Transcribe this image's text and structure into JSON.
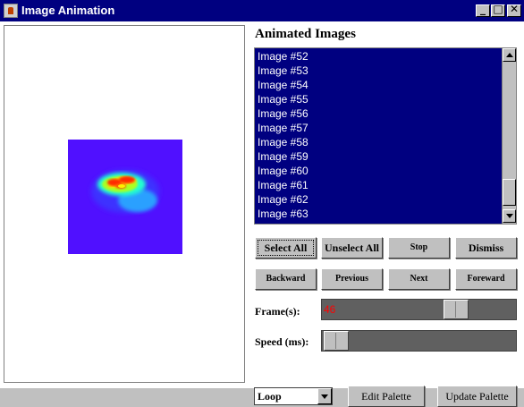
{
  "window": {
    "title": "Image Animation",
    "icon": "java-cup-icon",
    "controls": [
      {
        "name": "minimize-button",
        "icon": "minimize-icon",
        "glyph": "_"
      },
      {
        "name": "maximize-button",
        "icon": "maximize-icon",
        "glyph": "□"
      },
      {
        "name": "close-button",
        "icon": "close-icon",
        "glyph": "✕"
      }
    ]
  },
  "list": {
    "title": "Animated Images",
    "items": [
      "Image #52",
      "Image #53",
      "Image #54",
      "Image #55",
      "Image #56",
      "Image #57",
      "Image #58",
      "Image #59",
      "Image #60",
      "Image #61",
      "Image #62",
      "Image #63"
    ],
    "all_selected": true
  },
  "buttons": {
    "select_all": "Select All",
    "unselect_all": "Unselect All",
    "stop": "Stop",
    "dismiss": "Dismiss",
    "backward": "Backward",
    "previous": "Previous",
    "next": "Next",
    "foreward": "Foreward",
    "edit_palette": "Edit Palette",
    "update_palette": "Update Palette"
  },
  "frames": {
    "label": "Frame(s):",
    "value": "46"
  },
  "speed": {
    "label": "Speed (ms):",
    "value": "100"
  },
  "mode": {
    "selected": "Loop"
  },
  "colors": {
    "title_bar": "#000080",
    "list_bg": "#000080",
    "image_bg": "#5010ff",
    "slider_value": "#ff0000"
  }
}
